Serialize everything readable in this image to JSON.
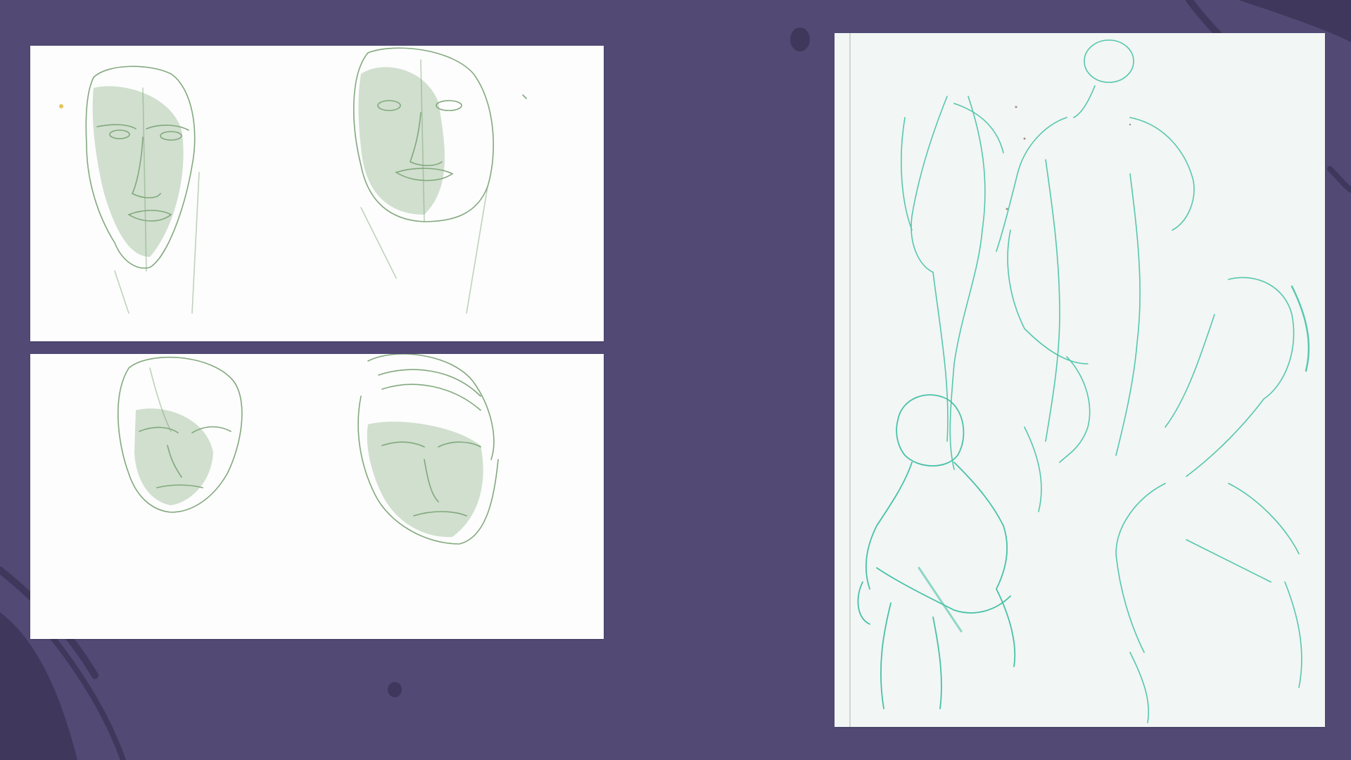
{
  "colors": {
    "background": "#524a75",
    "background_dark": "#3f385c",
    "paper": "#fcfdfc",
    "paper_right": "#f2f6f4",
    "pencil_green": "#5f8a5a",
    "pencil_teal": "#3fbfa3"
  },
  "sheets": [
    {
      "name": "face-studies-front-view",
      "icon": "pencil-sketch",
      "faces": 2
    },
    {
      "name": "face-studies-looking-down",
      "icon": "pencil-sketch",
      "faces": 2
    },
    {
      "name": "figure-gesture-studies",
      "icon": "pencil-sketch",
      "figures": 4
    }
  ]
}
